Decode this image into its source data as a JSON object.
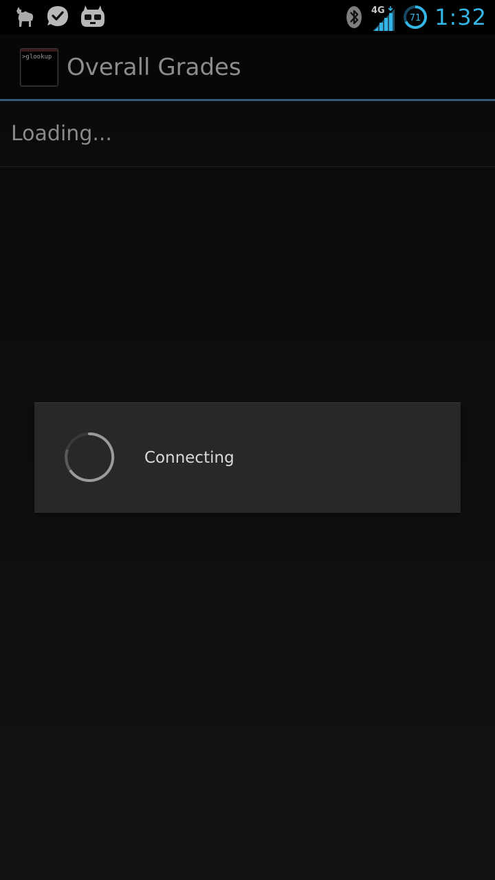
{
  "status_bar": {
    "left_icons": [
      "camel-icon",
      "check-bubble-icon",
      "cyanogen-mascot-icon"
    ],
    "network_type": "4G",
    "battery_level": "71",
    "clock": "1:32",
    "accent_color": "#33b5e5"
  },
  "action_bar": {
    "app_icon_text": ">glookup",
    "title": "Overall Grades",
    "divider_color": "#2f5b76"
  },
  "list": {
    "loading_text": "Loading..."
  },
  "dialog": {
    "message": "Connecting"
  }
}
